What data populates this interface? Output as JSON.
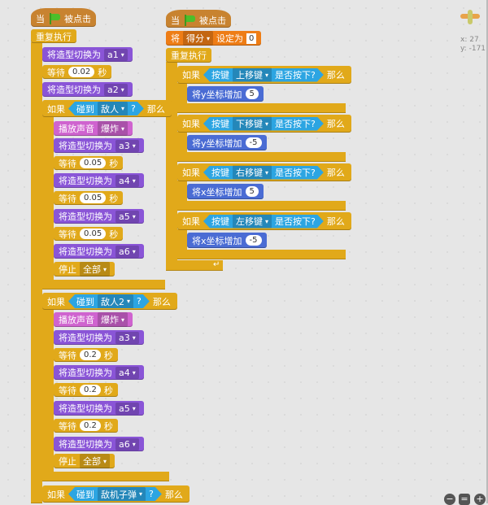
{
  "colors": {
    "events": "#c88330",
    "control": "#e1a91a",
    "looks": "#8a55d7",
    "sound": "#cf63cf",
    "data": "#ee7d16",
    "motion": "#4a6cd4",
    "sensing": "#2ca5e2"
  },
  "scripts": [
    {
      "blocks": [
        {
          "cat": "events",
          "parts": [
            {
              "t": "当"
            },
            {
              "icon": "green-flag"
            },
            {
              "t": "被点击"
            }
          ]
        },
        {
          "cat": "control",
          "parts": [
            {
              "t": "重复执行"
            }
          ]
        },
        {
          "cat": "looks",
          "parts": [
            {
              "t": "将造型切换为"
            },
            {
              "dd": "a1"
            }
          ]
        },
        {
          "cat": "control",
          "parts": [
            {
              "t": "等待"
            },
            {
              "num": "0.02"
            },
            {
              "t": "秒"
            }
          ]
        },
        {
          "cat": "looks",
          "parts": [
            {
              "t": "将造型切换为"
            },
            {
              "dd": "a2"
            }
          ]
        },
        {
          "cat": "control",
          "parts": [
            {
              "t": "如果"
            },
            {
              "bool": [
                {
                  "t": "碰到"
                },
                {
                  "dd": "敌人"
                },
                {
                  "t": "?"
                }
              ]
            },
            {
              "t": "那么"
            }
          ]
        },
        {
          "cat": "sound",
          "parts": [
            {
              "t": "播放声音"
            },
            {
              "dd": "爆炸"
            }
          ]
        },
        {
          "cat": "looks",
          "parts": [
            {
              "t": "将造型切换为"
            },
            {
              "dd": "a3"
            }
          ]
        },
        {
          "cat": "control",
          "parts": [
            {
              "t": "等待"
            },
            {
              "num": "0.05"
            },
            {
              "t": "秒"
            }
          ]
        },
        {
          "cat": "looks",
          "parts": [
            {
              "t": "将造型切换为"
            },
            {
              "dd": "a4"
            }
          ]
        },
        {
          "cat": "control",
          "parts": [
            {
              "t": "等待"
            },
            {
              "num": "0.05"
            },
            {
              "t": "秒"
            }
          ]
        },
        {
          "cat": "looks",
          "parts": [
            {
              "t": "将造型切换为"
            },
            {
              "dd": "a5"
            }
          ]
        },
        {
          "cat": "control",
          "parts": [
            {
              "t": "等待"
            },
            {
              "num": "0.05"
            },
            {
              "t": "秒"
            }
          ]
        },
        {
          "cat": "looks",
          "parts": [
            {
              "t": "将造型切换为"
            },
            {
              "dd": "a6"
            }
          ]
        },
        {
          "cat": "control",
          "parts": [
            {
              "t": "停止"
            },
            {
              "dd": "全部"
            }
          ]
        },
        {
          "cat": "control",
          "parts": [
            {
              "t": "如果"
            },
            {
              "bool": [
                {
                  "t": "碰到"
                },
                {
                  "dd": "敌人2"
                },
                {
                  "t": "?"
                }
              ]
            },
            {
              "t": "那么"
            }
          ]
        },
        {
          "cat": "sound",
          "parts": [
            {
              "t": "播放声音"
            },
            {
              "dd": "爆炸"
            }
          ]
        },
        {
          "cat": "looks",
          "parts": [
            {
              "t": "将造型切换为"
            },
            {
              "dd": "a3"
            }
          ]
        },
        {
          "cat": "control",
          "parts": [
            {
              "t": "等待"
            },
            {
              "num": "0.2"
            },
            {
              "t": "秒"
            }
          ]
        },
        {
          "cat": "looks",
          "parts": [
            {
              "t": "将造型切换为"
            },
            {
              "dd": "a4"
            }
          ]
        },
        {
          "cat": "control",
          "parts": [
            {
              "t": "等待"
            },
            {
              "num": "0.2"
            },
            {
              "t": "秒"
            }
          ]
        },
        {
          "cat": "looks",
          "parts": [
            {
              "t": "将造型切换为"
            },
            {
              "dd": "a5"
            }
          ]
        },
        {
          "cat": "control",
          "parts": [
            {
              "t": "等待"
            },
            {
              "num": "0.2"
            },
            {
              "t": "秒"
            }
          ]
        },
        {
          "cat": "looks",
          "parts": [
            {
              "t": "将造型切换为"
            },
            {
              "dd": "a6"
            }
          ]
        },
        {
          "cat": "control",
          "parts": [
            {
              "t": "停止"
            },
            {
              "dd": "全部"
            }
          ]
        },
        {
          "cat": "control",
          "parts": [
            {
              "t": "如果"
            },
            {
              "bool": [
                {
                  "t": "碰到"
                },
                {
                  "dd": "敌机子弹"
                },
                {
                  "t": "?"
                }
              ]
            },
            {
              "t": "那么"
            }
          ]
        }
      ]
    },
    {
      "blocks": [
        {
          "cat": "events",
          "parts": [
            {
              "t": "当"
            },
            {
              "icon": "green-flag"
            },
            {
              "t": "被点击"
            }
          ]
        },
        {
          "cat": "data",
          "parts": [
            {
              "t": "将"
            },
            {
              "dd": "得分"
            },
            {
              "t": "设定为"
            },
            {
              "val": "0"
            }
          ]
        },
        {
          "cat": "control",
          "parts": [
            {
              "t": "重复执行"
            }
          ]
        },
        {
          "cat": "control",
          "parts": [
            {
              "t": "如果"
            },
            {
              "bool": [
                {
                  "t": "按键"
                },
                {
                  "dd": "上移键"
                },
                {
                  "t": "是否按下?"
                }
              ]
            },
            {
              "t": "那么"
            }
          ]
        },
        {
          "cat": "motion",
          "parts": [
            {
              "t": "将y坐标增加"
            },
            {
              "num": "5"
            }
          ]
        },
        {
          "cat": "control",
          "parts": [
            {
              "t": "如果"
            },
            {
              "bool": [
                {
                  "t": "按键"
                },
                {
                  "dd": "下移键"
                },
                {
                  "t": "是否按下?"
                }
              ]
            },
            {
              "t": "那么"
            }
          ]
        },
        {
          "cat": "motion",
          "parts": [
            {
              "t": "将y坐标增加"
            },
            {
              "num": "-5"
            }
          ]
        },
        {
          "cat": "control",
          "parts": [
            {
              "t": "如果"
            },
            {
              "bool": [
                {
                  "t": "按键"
                },
                {
                  "dd": "右移键"
                },
                {
                  "t": "是否按下?"
                }
              ]
            },
            {
              "t": "那么"
            }
          ]
        },
        {
          "cat": "motion",
          "parts": [
            {
              "t": "将x坐标增加"
            },
            {
              "num": "5"
            }
          ]
        },
        {
          "cat": "control",
          "parts": [
            {
              "t": "如果"
            },
            {
              "bool": [
                {
                  "t": "按键"
                },
                {
                  "dd": "左移键"
                },
                {
                  "t": "是否按下?"
                }
              ]
            },
            {
              "t": "那么"
            }
          ]
        },
        {
          "cat": "motion",
          "parts": [
            {
              "t": "将x坐标增加"
            },
            {
              "num": "-5"
            }
          ]
        }
      ]
    }
  ],
  "sprite": {
    "x_label": "x:",
    "x_value": "27",
    "y_label": "y:",
    "y_value": "-171"
  },
  "zoom": {
    "out": "−",
    "reset": "=",
    "in": "+"
  }
}
